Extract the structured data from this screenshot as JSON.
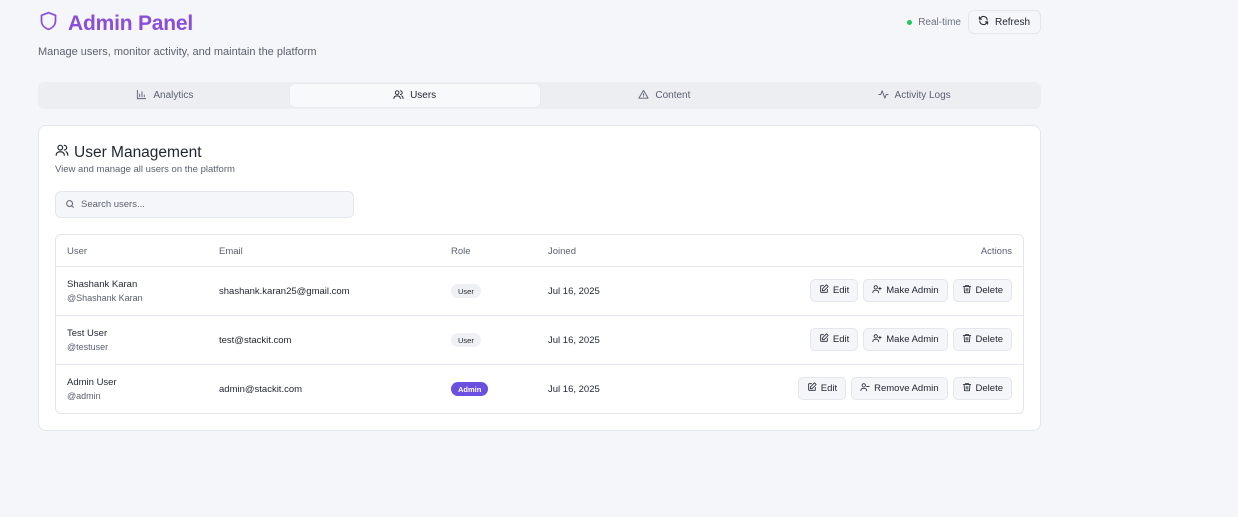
{
  "header": {
    "title": "Admin Panel",
    "subtitle": "Manage users, monitor activity, and maintain the platform",
    "realtime_label": "Real-time",
    "refresh_label": "Refresh"
  },
  "tabs": [
    {
      "label": "Analytics",
      "icon": "bar-chart-icon"
    },
    {
      "label": "Users",
      "icon": "users-icon",
      "active": true
    },
    {
      "label": "Content",
      "icon": "warning-triangle-icon"
    },
    {
      "label": "Activity Logs",
      "icon": "activity-icon"
    }
  ],
  "card": {
    "title": "User Management",
    "subtitle": "View and manage all users on the platform"
  },
  "search": {
    "placeholder": "Search users..."
  },
  "table": {
    "columns": {
      "user": "User",
      "email": "Email",
      "role": "Role",
      "joined": "Joined",
      "actions": "Actions"
    },
    "rows": [
      {
        "name": "Shashank Karan",
        "handle": "@Shashank Karan",
        "email": "shashank.karan25@gmail.com",
        "role": "User",
        "joined": "Jul 16, 2025",
        "edit": "Edit",
        "toggle_admin": "Make Admin",
        "delete": "Delete"
      },
      {
        "name": "Test User",
        "handle": "@testuser",
        "email": "test@stackit.com",
        "role": "User",
        "joined": "Jul 16, 2025",
        "edit": "Edit",
        "toggle_admin": "Make Admin",
        "delete": "Delete"
      },
      {
        "name": "Admin User",
        "handle": "@admin",
        "email": "admin@stackit.com",
        "role": "Admin",
        "joined": "Jul 16, 2025",
        "edit": "Edit",
        "toggle_admin": "Remove Admin",
        "delete": "Delete"
      }
    ]
  },
  "colors": {
    "brand": "#8b4ed8",
    "admin_badge": "#6b4fe0",
    "realtime_dot": "#22c55e"
  }
}
